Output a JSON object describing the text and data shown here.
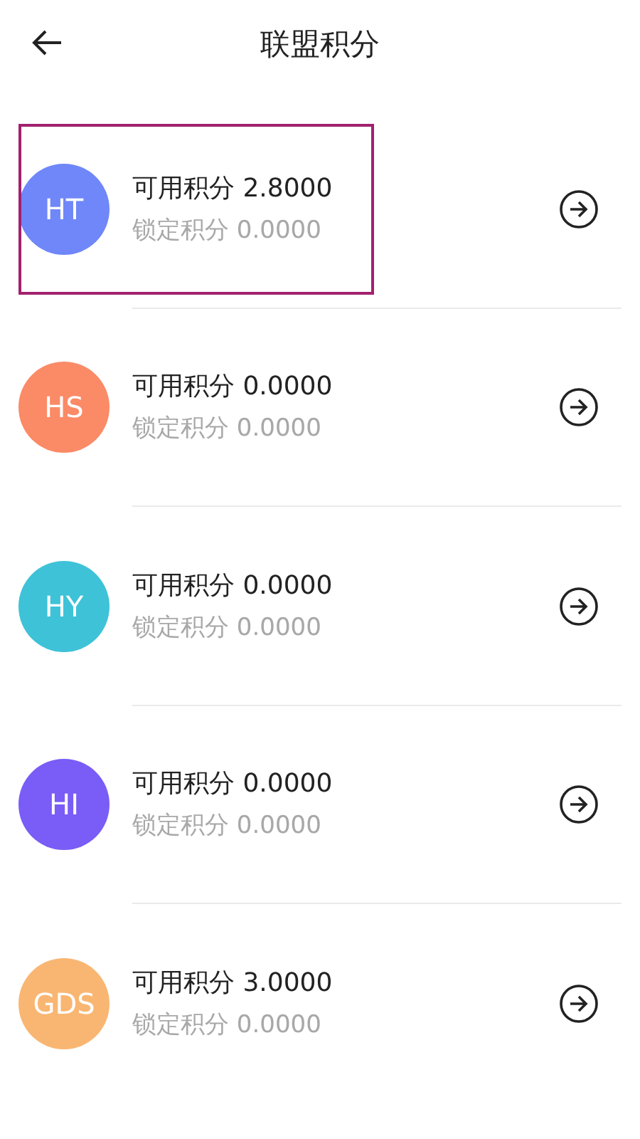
{
  "header": {
    "title": "联盟积分"
  },
  "accounts": [
    {
      "code": "HT",
      "color": "#6f87f8",
      "available": "可用积分 2.8000",
      "locked": "锁定积分 0.0000",
      "selected": true
    },
    {
      "code": "HS",
      "color": "#fb8a66",
      "available": "可用积分 0.0000",
      "locked": "锁定积分 0.0000",
      "selected": false
    },
    {
      "code": "HY",
      "color": "#3ec2d8",
      "available": "可用积分 0.0000",
      "locked": "锁定积分 0.0000",
      "selected": false
    },
    {
      "code": "HI",
      "color": "#7a5cf6",
      "available": "可用积分 0.0000",
      "locked": "锁定积分 0.0000",
      "selected": false
    },
    {
      "code": "GDS",
      "color": "#f9b672",
      "available": "可用积分 3.0000",
      "locked": "锁定积分 0.0000",
      "selected": false
    }
  ]
}
